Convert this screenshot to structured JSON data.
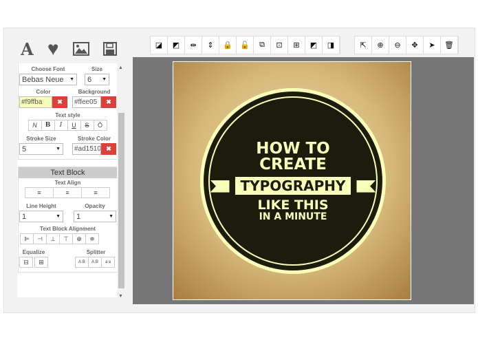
{
  "top_icons": [
    {
      "name": "text-icon",
      "glyph": "A"
    },
    {
      "name": "heart-icon",
      "glyph": "♥"
    },
    {
      "name": "image-icon",
      "glyph": "🖼"
    },
    {
      "name": "save-icon",
      "glyph": "💾"
    }
  ],
  "font": {
    "label": "Choose Font",
    "value": "Bebas Neue",
    "size_label": "Size",
    "size_value": "6"
  },
  "color": {
    "label": "Color",
    "value": "#f9ffba",
    "bg_label": "Background",
    "bg_value": "#ffee05",
    "clear": "✖"
  },
  "text_style": {
    "label": "Text style",
    "buttons": [
      "N",
      "B",
      "I",
      "U",
      "S",
      "Ō"
    ]
  },
  "stroke": {
    "size_label": "Stroke Size",
    "size_value": "5",
    "color_label": "Stroke Color",
    "color_value": "#ad1510"
  },
  "text_block": {
    "title": "Text Block",
    "align_label": "Text Align",
    "align_buttons": [
      "≡",
      "≡",
      "≡"
    ],
    "line_height_label": "Line Height",
    "line_height_value": "1",
    "opacity_label": "Opacity",
    "opacity_value": "1",
    "block_align_label": "Text Block Alignment",
    "block_align_buttons": [
      "⊫",
      "⊣",
      "⊥",
      "⊤",
      "⊕",
      "≑"
    ],
    "equalize_label": "Equalize",
    "equalize_buttons": [
      "⊟",
      "⊞"
    ],
    "splitter_label": "Splitter",
    "splitter_buttons": [
      "A:B",
      "A,B",
      "a a"
    ]
  },
  "toolbar1": [
    "◪",
    "◩",
    "⇹",
    "⇕",
    "🔒",
    "🔓",
    "⧉",
    "⊡",
    "⊞",
    "◩",
    "◨"
  ],
  "toolbar1_names": [
    "bring-front-icon",
    "send-back-icon",
    "flip-horizontal-icon",
    "flip-vertical-icon",
    "lock-icon",
    "unlock-icon",
    "duplicate-icon",
    "fit-icon",
    "resize-icon",
    "contrast-icon",
    "crop-icon"
  ],
  "toolbar2": [
    "⇱",
    "⊕",
    "⊖",
    "✥",
    "➤",
    "🗑"
  ],
  "toolbar2_names": [
    "scale-icon",
    "zoom-in-icon",
    "zoom-out-icon",
    "move-icon",
    "pointer-icon",
    "trash-icon"
  ],
  "artwork": {
    "line1": "HOW TO",
    "line2": "CREATE",
    "line3": "TYPOGRAPHY",
    "line4": "LIKE THIS",
    "line5": "IN A MINUTE"
  }
}
